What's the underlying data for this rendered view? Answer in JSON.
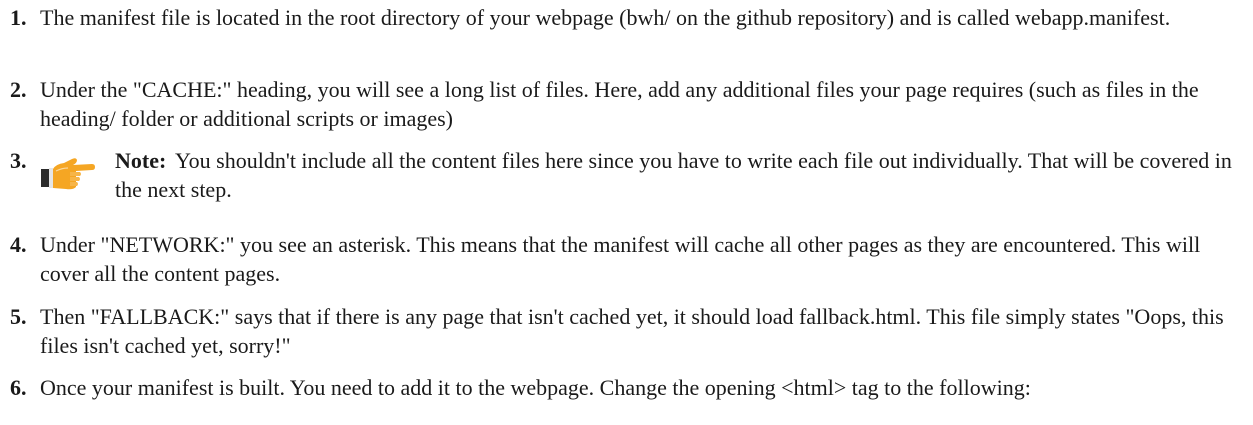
{
  "steps": [
    {
      "num": "1.",
      "text": "The manifest file is located in the root directory of your webpage (bwh/ on the github repository) and is called webapp.manifest."
    },
    {
      "num": "2.",
      "text": "Under the \"CACHE:\" heading, you will see a long list of files. Here, add any additional files your page requires (such as files in the heading/ folder or additional scripts or images)"
    },
    {
      "num": "3.",
      "note_label": "Note:",
      "note_text": "You shouldn't include all the content files here since you have to write each file out individually. That will be covered in the next step.",
      "icon": "pointing-hand-icon"
    },
    {
      "num": "4.",
      "text": "Under \"NETWORK:\" you see an asterisk. This means that the manifest will cache all other pages as they are encountered. This will cover all the content pages."
    },
    {
      "num": "5.",
      "text": "Then \"FALLBACK:\" says that if there is any page that isn't cached yet, it should load fallback.html. This file simply states \"Oops, this files isn't cached yet, sorry!\""
    },
    {
      "num": "6.",
      "text": "Once your manifest is built. You need to add it to the webpage. Change the opening <html> tag to the following:"
    }
  ],
  "colors": {
    "text": "#1a1a1a",
    "icon_orange": "#f5a623",
    "icon_dark": "#2b2b2b"
  }
}
